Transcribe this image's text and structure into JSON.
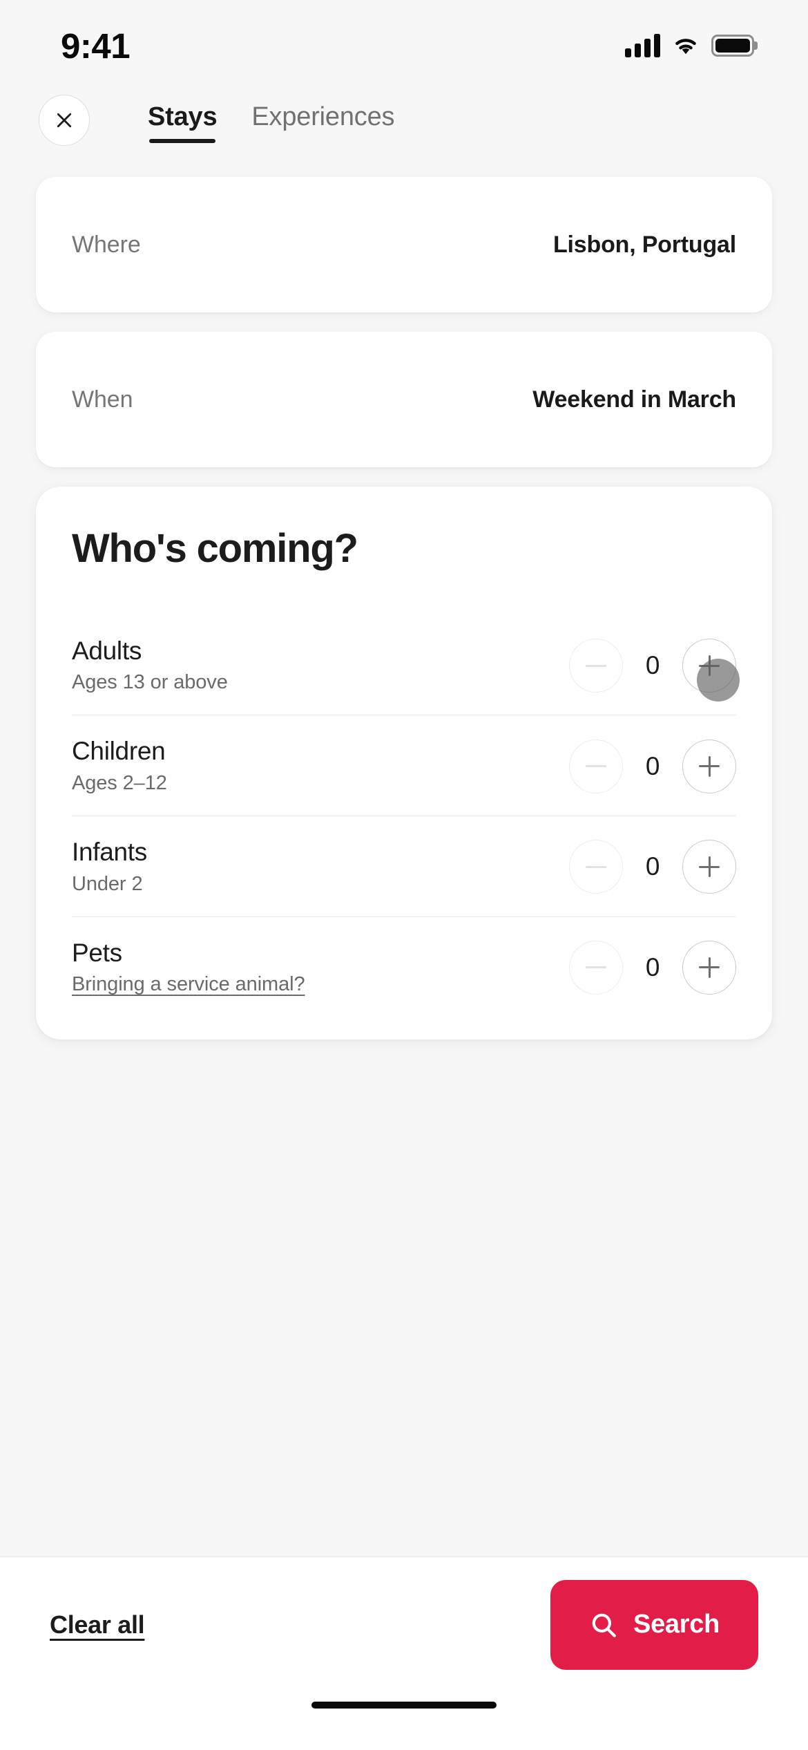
{
  "status_bar": {
    "time": "9:41",
    "cellular_icon": "signal-bars-icon",
    "wifi_icon": "wifi-icon",
    "battery_icon": "battery-full-icon"
  },
  "header": {
    "close_icon": "close-icon",
    "tabs": [
      {
        "label": "Stays",
        "active": true
      },
      {
        "label": "Experiences",
        "active": false
      }
    ]
  },
  "search_fields": [
    {
      "label": "Where",
      "value": "Lisbon, Portugal"
    },
    {
      "label": "When",
      "value": "Weekend in March"
    }
  ],
  "guest_card": {
    "title": "Who's coming?",
    "rows": [
      {
        "name": "Adults",
        "subtitle": "Ages 13 or above",
        "subtitle_is_link": false,
        "count": "0",
        "minus_icon": "minus-icon",
        "plus_icon": "plus-icon",
        "minus_disabled": true,
        "pressed": true
      },
      {
        "name": "Children",
        "subtitle": "Ages 2–12",
        "subtitle_is_link": false,
        "count": "0",
        "minus_icon": "minus-icon",
        "plus_icon": "plus-icon",
        "minus_disabled": true,
        "pressed": false
      },
      {
        "name": "Infants",
        "subtitle": "Under 2",
        "subtitle_is_link": false,
        "count": "0",
        "minus_icon": "minus-icon",
        "plus_icon": "plus-icon",
        "minus_disabled": true,
        "pressed": false
      },
      {
        "name": "Pets",
        "subtitle": "Bringing a service animal?",
        "subtitle_is_link": true,
        "count": "0",
        "minus_icon": "minus-icon",
        "plus_icon": "plus-icon",
        "minus_disabled": true,
        "pressed": false
      }
    ]
  },
  "bottom_bar": {
    "clear_all_label": "Clear all",
    "search_label": "Search",
    "search_icon": "search-icon",
    "search_button_color": "#e11d48"
  },
  "colors": {
    "background": "#f7f7f8",
    "card": "#ffffff",
    "text_primary": "#1c1c1c",
    "text_secondary": "#767676",
    "accent": "#e11d48"
  }
}
